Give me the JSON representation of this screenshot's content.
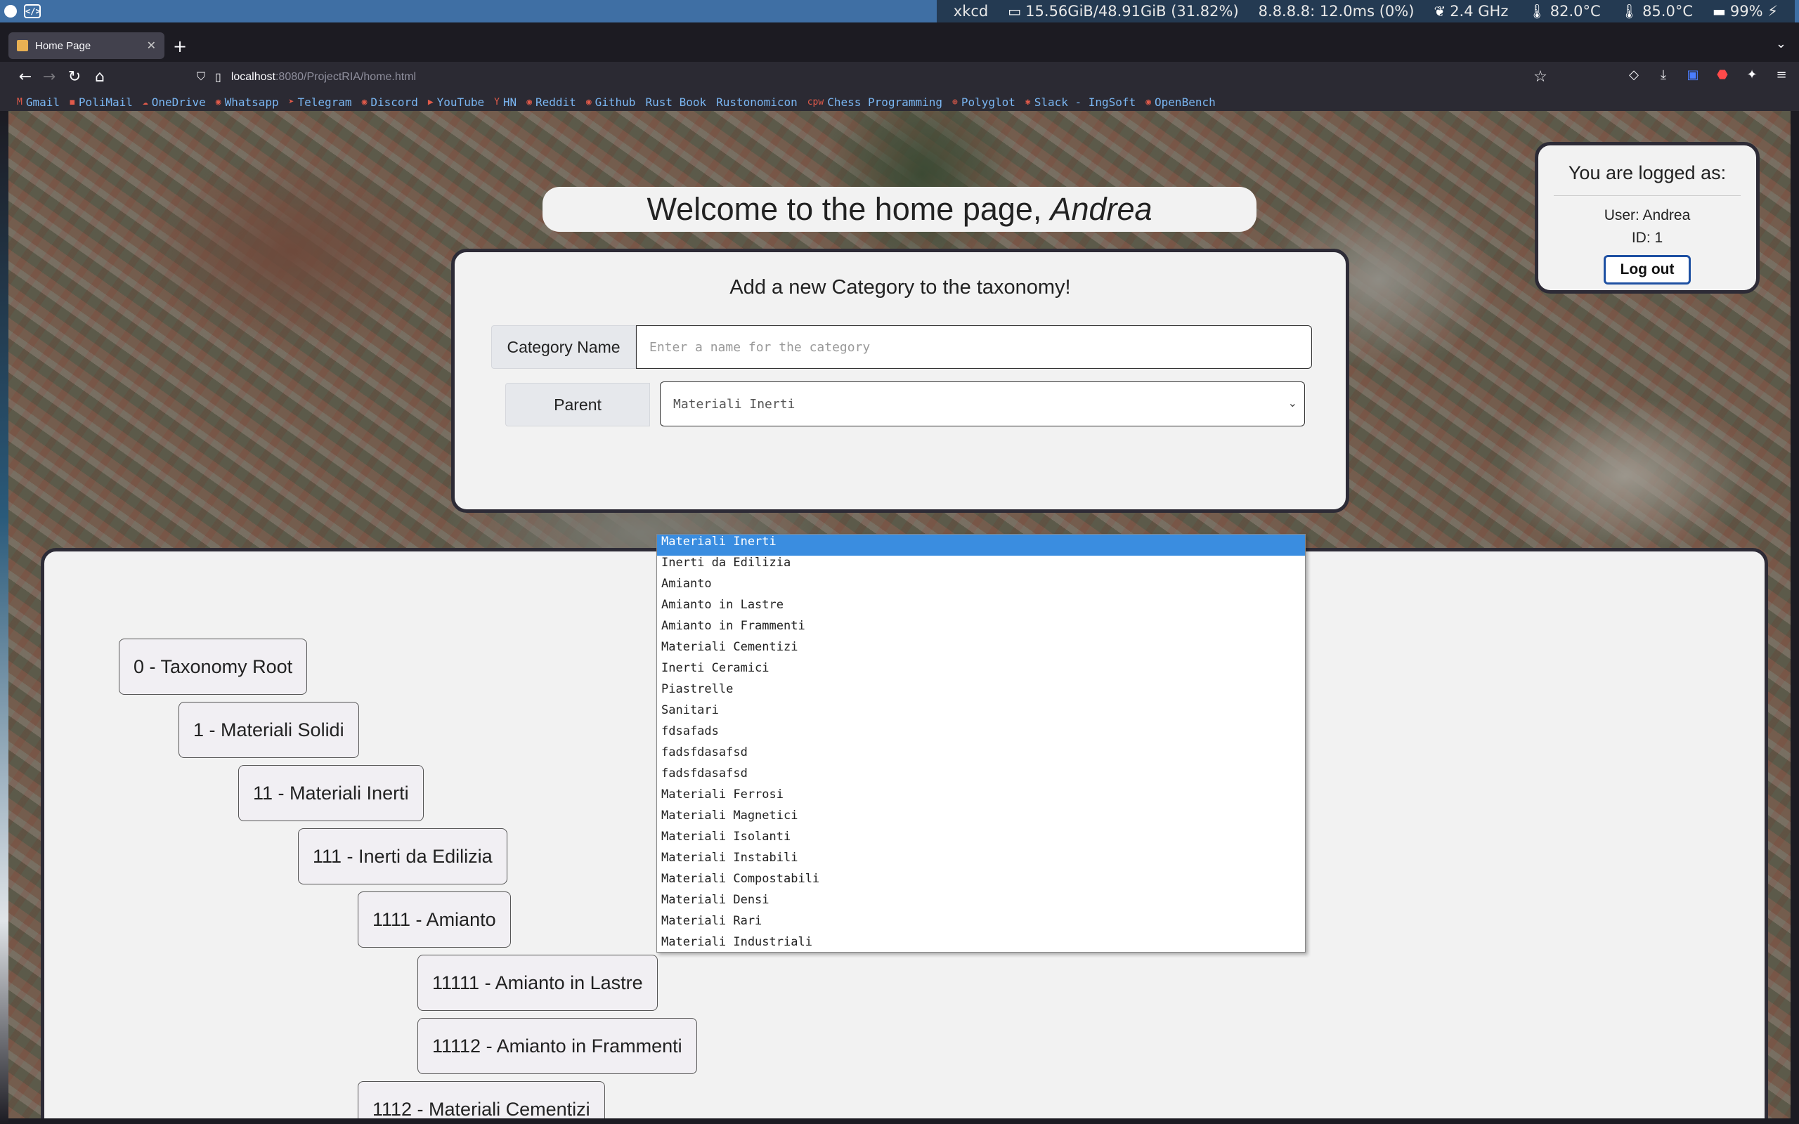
{
  "sysbar": {
    "modules": [
      {
        "icon": "",
        "text": "xkcd"
      },
      {
        "icon": "▭",
        "text": "15.56GiB/48.91GiB (31.82%)"
      },
      {
        "icon": "",
        "text": "8.8.8.8: 12.0ms (0%)"
      },
      {
        "icon": "❦",
        "text": "2.4 GHz"
      },
      {
        "icon": "🌡",
        "text": "82.0°C"
      },
      {
        "icon": "🌡",
        "text": "85.0°C"
      },
      {
        "icon": "▬",
        "text": "99% ⚡"
      }
    ]
  },
  "browser": {
    "tab_title": "Home Page",
    "url_host": "localhost",
    "url_path": ":8080/ProjectRIA/home.html",
    "bookmarks": [
      {
        "icon": "M",
        "label": "Gmail"
      },
      {
        "icon": "◼",
        "label": "PoliMail"
      },
      {
        "icon": "☁",
        "label": "OneDrive"
      },
      {
        "icon": "◉",
        "label": "Whatsapp"
      },
      {
        "icon": "➤",
        "label": "Telegram"
      },
      {
        "icon": "◉",
        "label": "Discord"
      },
      {
        "icon": "▶",
        "label": "YouTube"
      },
      {
        "icon": "Y",
        "label": "HN"
      },
      {
        "icon": "◉",
        "label": "Reddit"
      },
      {
        "icon": "◉",
        "label": "Github"
      },
      {
        "icon": "",
        "label": "Rust Book"
      },
      {
        "icon": "",
        "label": "Rustonomicon"
      },
      {
        "icon": "cpw",
        "label": "Chess Programming"
      },
      {
        "icon": "⊕",
        "label": "Polyglot"
      },
      {
        "icon": "✱",
        "label": "Slack - IngSoft"
      },
      {
        "icon": "◉",
        "label": "OpenBench"
      }
    ]
  },
  "welcome": {
    "prefix": "Welcome to the home page,",
    "name": "Andrea"
  },
  "form": {
    "heading": "Add a new Category to the taxonomy!",
    "name_label": "Category Name",
    "name_placeholder": "Enter a name for the category",
    "parent_label": "Parent",
    "parent_selected": "Materiali Inerti",
    "options": [
      "Materiali Inerti",
      "Inerti da Edilizia",
      "Amianto",
      "Amianto in Lastre",
      "Amianto in Frammenti",
      "Materiali Cementizi",
      "Inerti Ceramici",
      "Piastrelle",
      "Sanitari",
      "fdsafads",
      "fadsfdasafsd",
      "fadsfdasafsd",
      "Materiali Ferrosi",
      "Materiali Magnetici",
      "Materiali Isolanti",
      "Materiali Instabili",
      "Materiali Compostabili",
      "Materiali Densi",
      "Materiali Rari",
      "Materiali Industriali"
    ]
  },
  "user": {
    "heading": "You are logged as:",
    "user_line": "User: Andrea",
    "id_line": "ID: 1",
    "logout_label": "Log out"
  },
  "tree": [
    {
      "label": "0 - Taxonomy Root",
      "depth": 0
    },
    {
      "label": "1 - Materiali Solidi",
      "depth": 1
    },
    {
      "label": "11 - Materiali Inerti",
      "depth": 2
    },
    {
      "label": "111 - Inerti da Edilizia",
      "depth": 3
    },
    {
      "label": "1111 - Amianto",
      "depth": 4
    },
    {
      "label": "11111 - Amianto in Lastre",
      "depth": 5
    },
    {
      "label": "11112 - Amianto in Frammenti",
      "depth": 5
    },
    {
      "label": "1112 - Materiali Cementizi",
      "depth": 4
    }
  ]
}
